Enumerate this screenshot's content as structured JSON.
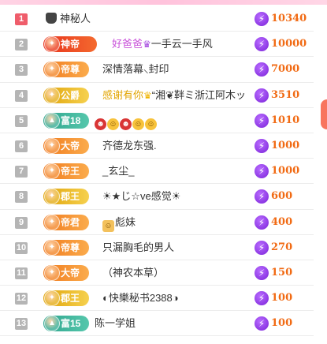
{
  "rows": [
    {
      "rank": "1",
      "name": "神秘人",
      "amount": "10340"
    },
    {
      "rank": "2",
      "badge": "神帝",
      "name": "好爸爸",
      "tail": "一手云一手风",
      "amount": "10000"
    },
    {
      "rank": "3",
      "badge": "帝尊",
      "name": "深情落幕⸜封印",
      "amount": "7000"
    },
    {
      "rank": "4",
      "badge": "公爵",
      "name": "感谢有你",
      "tail": "“湘❦靽ミ浙江阿木ッ",
      "amount": "3510"
    },
    {
      "rank": "5",
      "badge": "富18",
      "name": "",
      "amount": "1010"
    },
    {
      "rank": "6",
      "badge": "大帝",
      "name": "齐德龙东强.",
      "amount": "1000"
    },
    {
      "rank": "7",
      "badge": "帝王",
      "name": "_玄尘_",
      "amount": "1000"
    },
    {
      "rank": "8",
      "badge": "郡王",
      "name": "☀★じ☆ve感觉☀",
      "amount": "600"
    },
    {
      "rank": "9",
      "badge": "帝君",
      "name": "彪妹",
      "amount": "400"
    },
    {
      "rank": "10",
      "badge": "帝尊",
      "name": "只漏胸毛的男人",
      "amount": "270"
    },
    {
      "rank": "11",
      "badge": "大帝",
      "name": "（神农本草）",
      "amount": "150"
    },
    {
      "rank": "12",
      "badge": "郡王",
      "name": "◐快樂秘书2388◑",
      "amount": "100"
    },
    {
      "rank": "13",
      "badge": "富15",
      "name": "陈一学姐",
      "amount": "100"
    }
  ],
  "icons": {
    "currency": "lightning-bolt-icon",
    "incognito": "incognito-icon",
    "crown": "crown-icon"
  },
  "colors": {
    "accent_amount": "#f16a13",
    "rank_first": "#ef5d6b",
    "rank_default": "#b5b5b5",
    "bolt": "#8a2be2",
    "vip_name": "#c84fd9",
    "gold_name": "#e2a400"
  }
}
